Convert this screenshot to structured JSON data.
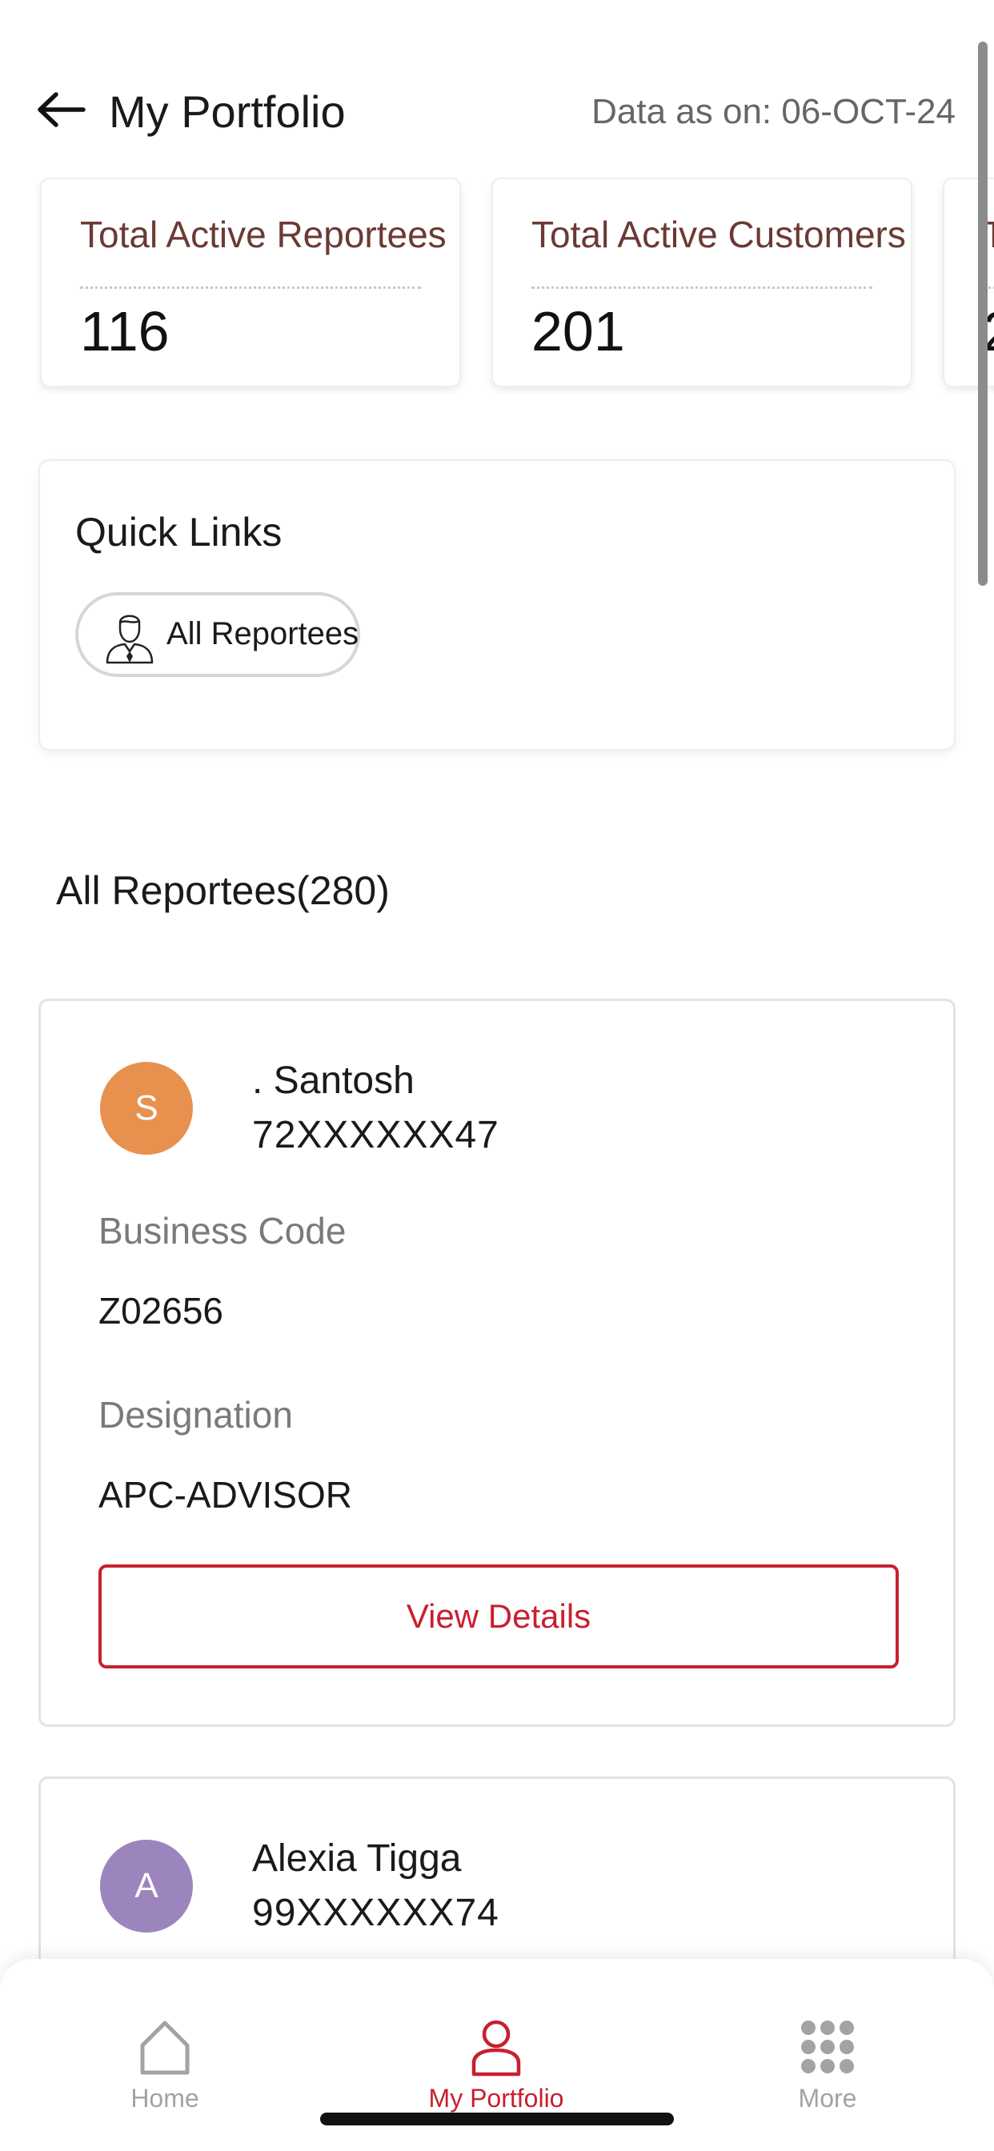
{
  "header": {
    "title": "My Portfolio",
    "data_date": "Data as on: 06-OCT-24",
    "back_icon": "arrow-left-icon"
  },
  "stats": [
    {
      "label": "Total Active Reportees",
      "value": "116"
    },
    {
      "label": "Total Active Customers",
      "value": "201"
    },
    {
      "label": "T",
      "value": "2"
    }
  ],
  "quick_links": {
    "title": "Quick Links",
    "items": [
      {
        "label": "All Reportees",
        "icon": "person-tie-icon"
      }
    ]
  },
  "reportees": {
    "heading": "All Reportees(280)",
    "items": [
      {
        "initial": "S",
        "avatar_color": "#e8914f",
        "name": ". Santosh",
        "phone": "72XXXXXX47",
        "business_code_label": "Business Code",
        "business_code": "Z02656",
        "designation_label": "Designation",
        "designation": "APC-ADVISOR",
        "button_label": "View Details"
      },
      {
        "initial": "A",
        "avatar_color": "#9c84bd",
        "name": "Alexia Tigga",
        "phone": "99XXXXXX74"
      }
    ]
  },
  "bottom_nav": {
    "items": [
      {
        "label": "Home",
        "icon": "home-icon",
        "active": false
      },
      {
        "label": "My Portfolio",
        "icon": "person-icon",
        "active": true
      },
      {
        "label": "More",
        "icon": "grid-dots-icon",
        "active": false
      }
    ]
  },
  "colors": {
    "accent": "#c8202f",
    "stat_label": "#6b3a34",
    "muted_text": "#7a7a7a",
    "nav_inactive": "#a3a3a3"
  }
}
